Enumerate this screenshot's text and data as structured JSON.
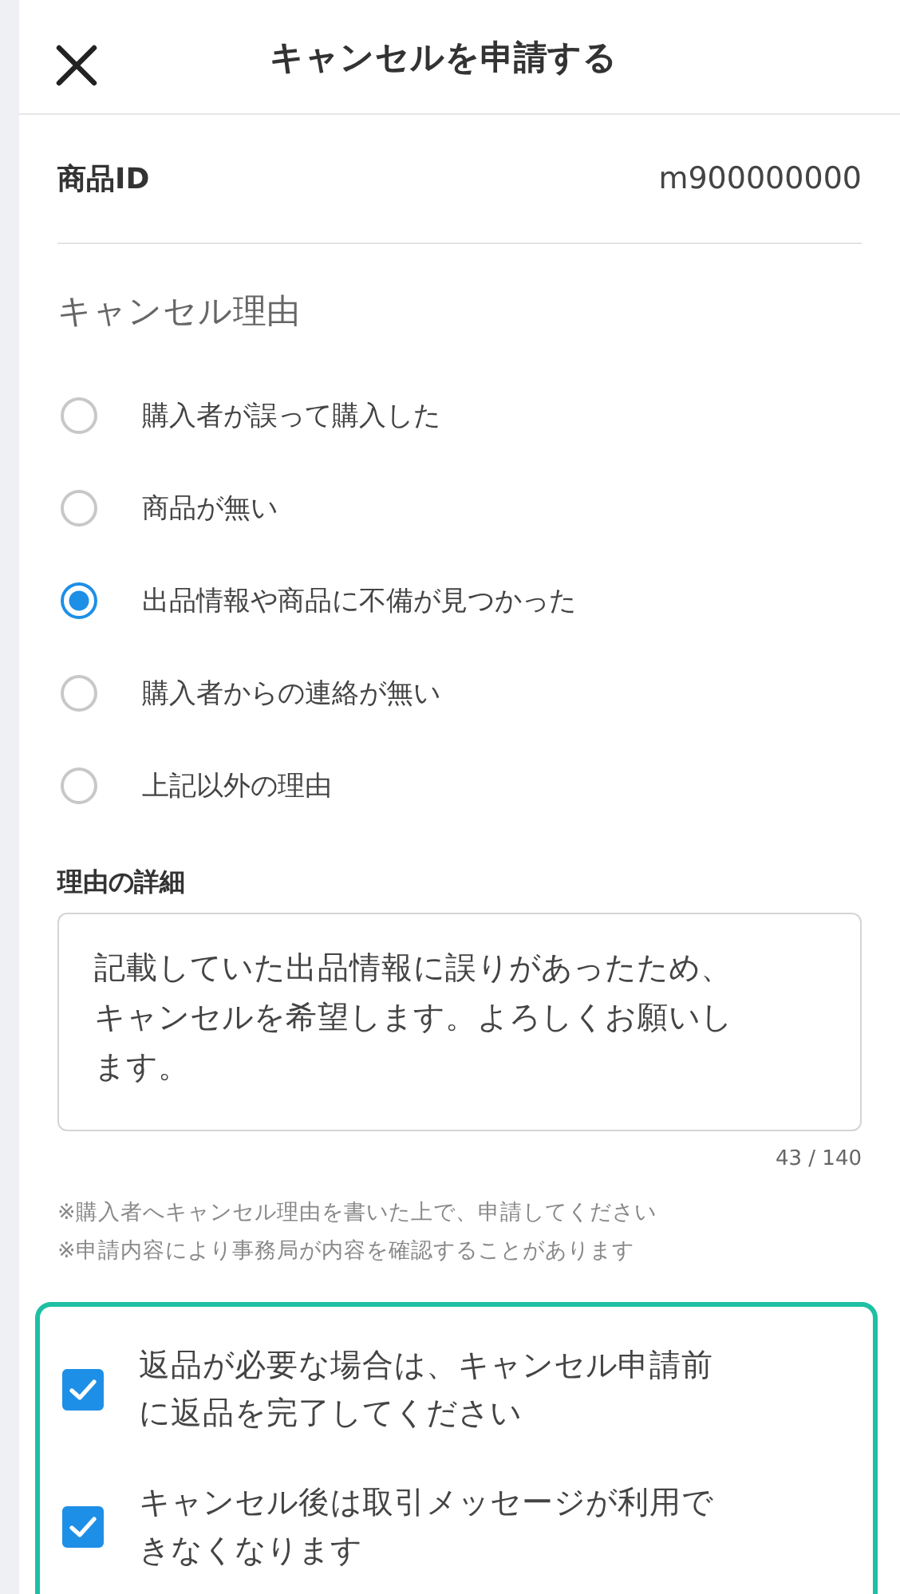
{
  "header": {
    "title": "キャンセルを申請する"
  },
  "product_id": {
    "label": "商品ID",
    "value": "m900000000"
  },
  "reasons": {
    "heading": "キャンセル理由",
    "options": [
      {
        "label": "購入者が誤って購入した",
        "selected": false
      },
      {
        "label": "商品が無い",
        "selected": false
      },
      {
        "label": "出品情報や商品に不備が見つかった",
        "selected": true
      },
      {
        "label": "購入者からの連絡が無い",
        "selected": false
      },
      {
        "label": "上記以外の理由",
        "selected": false
      }
    ]
  },
  "detail": {
    "label": "理由の詳細",
    "value": "記載していた出品情報に誤りがあったため、キャンセルを希望します。よろしくお願いします。",
    "counter": "43 / 140"
  },
  "notes": [
    "※購入者へキャンセル理由を書いた上で、申請してください",
    "※申請内容により事務局が内容を確認することがあります"
  ],
  "confirmations": [
    {
      "label": "返品が必要な場合は、キャンセル申請前に返品を完了してください",
      "checked": true
    },
    {
      "label": "キャンセル後は取引メッセージが利用できなくなります",
      "checked": true
    }
  ]
}
